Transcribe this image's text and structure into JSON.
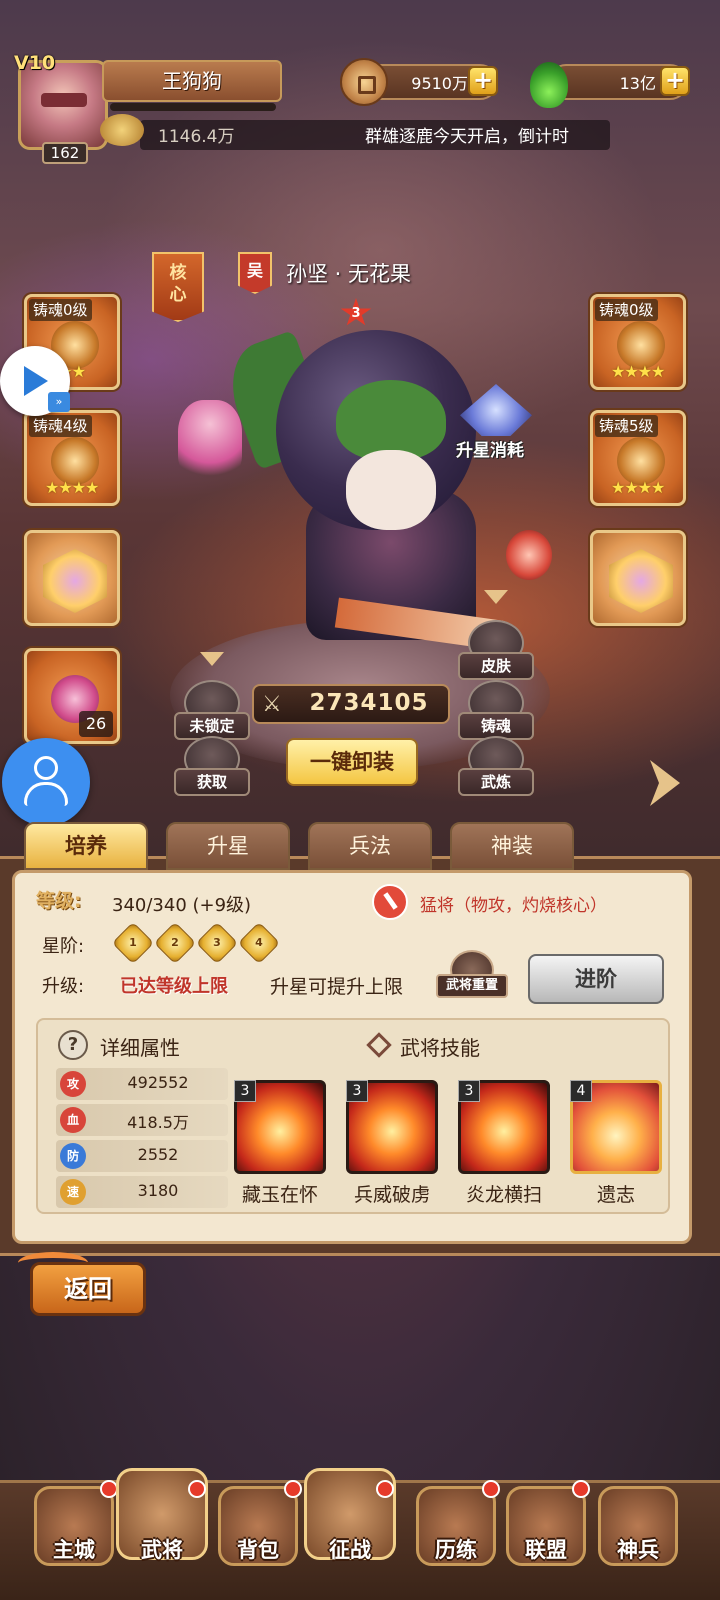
{
  "player": {
    "vip": "V10",
    "name": "王狗狗",
    "level": "162",
    "power": "1146.4万"
  },
  "currency": {
    "coins": "9510万",
    "potions": "13亿"
  },
  "marquee": "群雄逐鹿今天开启，倒计时",
  "hero": {
    "core_label": "核心",
    "faction": "吴",
    "name": "孙坚 · 无花果",
    "star": "3",
    "upgrade_cost_label": "升星消耗",
    "combat_power": "2734105"
  },
  "slots": {
    "left": [
      {
        "tag": "铸魂0级",
        "stars": "★★★"
      },
      {
        "tag": "铸魂4级",
        "stars": "★★★★"
      }
    ],
    "right": [
      {
        "tag": "铸魂0级",
        "stars": "★★★★"
      },
      {
        "tag": "铸魂5级",
        "stars": "★★★★"
      }
    ],
    "companion_count": "26"
  },
  "actions": {
    "lock": "未锁定",
    "obtain": "获取",
    "unequip_all": "一键卸装",
    "skin": "皮肤",
    "forge": "铸魂",
    "training": "武炼"
  },
  "tabs": [
    "培养",
    "升星",
    "兵法",
    "神装"
  ],
  "cultivate": {
    "level_label": "等级:",
    "level_value": "340/340 (+9级)",
    "type_text": "猛将（物攻，灼烧核心）",
    "rank_label": "星阶:",
    "rank_steps": [
      "1",
      "2",
      "3",
      "4"
    ],
    "upgrade_label": "升级:",
    "max_level": "已达等级上限",
    "upgrade_note": "升星可提升上限",
    "reset_label": "武将重置",
    "advance_label": "进阶"
  },
  "details": {
    "attr_title": "详细属性",
    "skill_title": "武将技能",
    "stats": [
      {
        "icon": "攻",
        "value": "492552",
        "color": "#d8453a"
      },
      {
        "icon": "血",
        "value": "418.5万",
        "color": "#d8453a"
      },
      {
        "icon": "防",
        "value": "2552",
        "color": "#3a7ad8"
      },
      {
        "icon": "速",
        "value": "3180",
        "color": "#e0a030"
      }
    ],
    "skills": [
      {
        "level": "3",
        "name": "藏玉在怀"
      },
      {
        "level": "3",
        "name": "兵威破虏"
      },
      {
        "level": "3",
        "name": "炎龙横扫"
      },
      {
        "level": "4",
        "name": "遗志"
      }
    ]
  },
  "back_label": "返回",
  "nav": [
    "主城",
    "武将",
    "背包",
    "征战",
    "历练",
    "联盟",
    "神兵"
  ]
}
